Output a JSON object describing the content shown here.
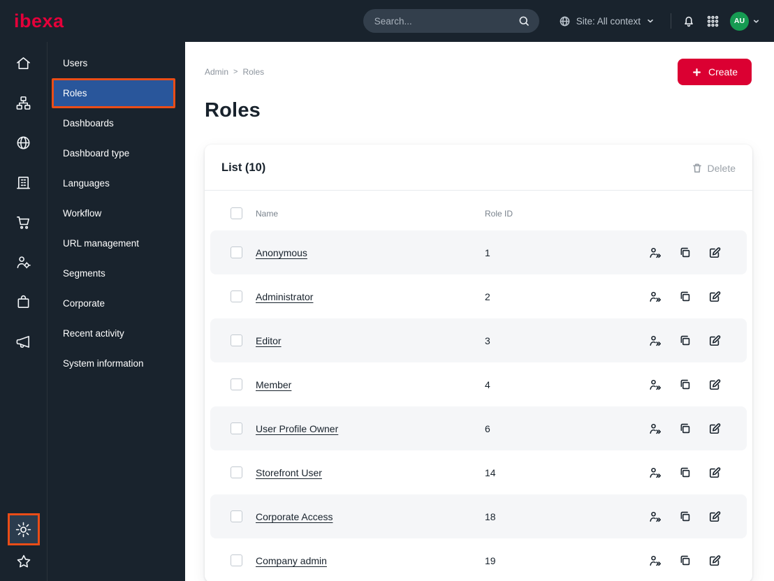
{
  "topbar": {
    "logo": "ibexa",
    "search_placeholder": "Search...",
    "site_context": "Site: All context",
    "avatar_initials": "AU"
  },
  "sidebar": {
    "items": [
      "Users",
      "Roles",
      "Dashboards",
      "Dashboard type",
      "Languages",
      "Workflow",
      "URL management",
      "Segments",
      "Corporate",
      "Recent activity",
      "System information"
    ],
    "selected": "Roles"
  },
  "breadcrumb": {
    "items": [
      "Admin",
      "Roles"
    ],
    "separator": ">"
  },
  "page": {
    "title": "Roles",
    "create_label": "Create"
  },
  "list": {
    "title": "List (10)",
    "delete_label": "Delete",
    "columns": [
      "Name",
      "Role ID"
    ],
    "rows": [
      {
        "name": "Anonymous",
        "role_id": "1"
      },
      {
        "name": "Administrator",
        "role_id": "2"
      },
      {
        "name": "Editor",
        "role_id": "3"
      },
      {
        "name": "Member",
        "role_id": "4"
      },
      {
        "name": "User Profile Owner",
        "role_id": "6"
      },
      {
        "name": "Storefront User",
        "role_id": "14"
      },
      {
        "name": "Corporate Access",
        "role_id": "18"
      },
      {
        "name": "Company admin",
        "role_id": "19"
      }
    ]
  },
  "colors": {
    "brand_red": "#e4003a",
    "accent_red": "#db0032",
    "selected_blue": "#29569b",
    "highlight_orange": "#ea4d17",
    "dark_navy": "#19232d",
    "avatar_green": "#169b52"
  }
}
